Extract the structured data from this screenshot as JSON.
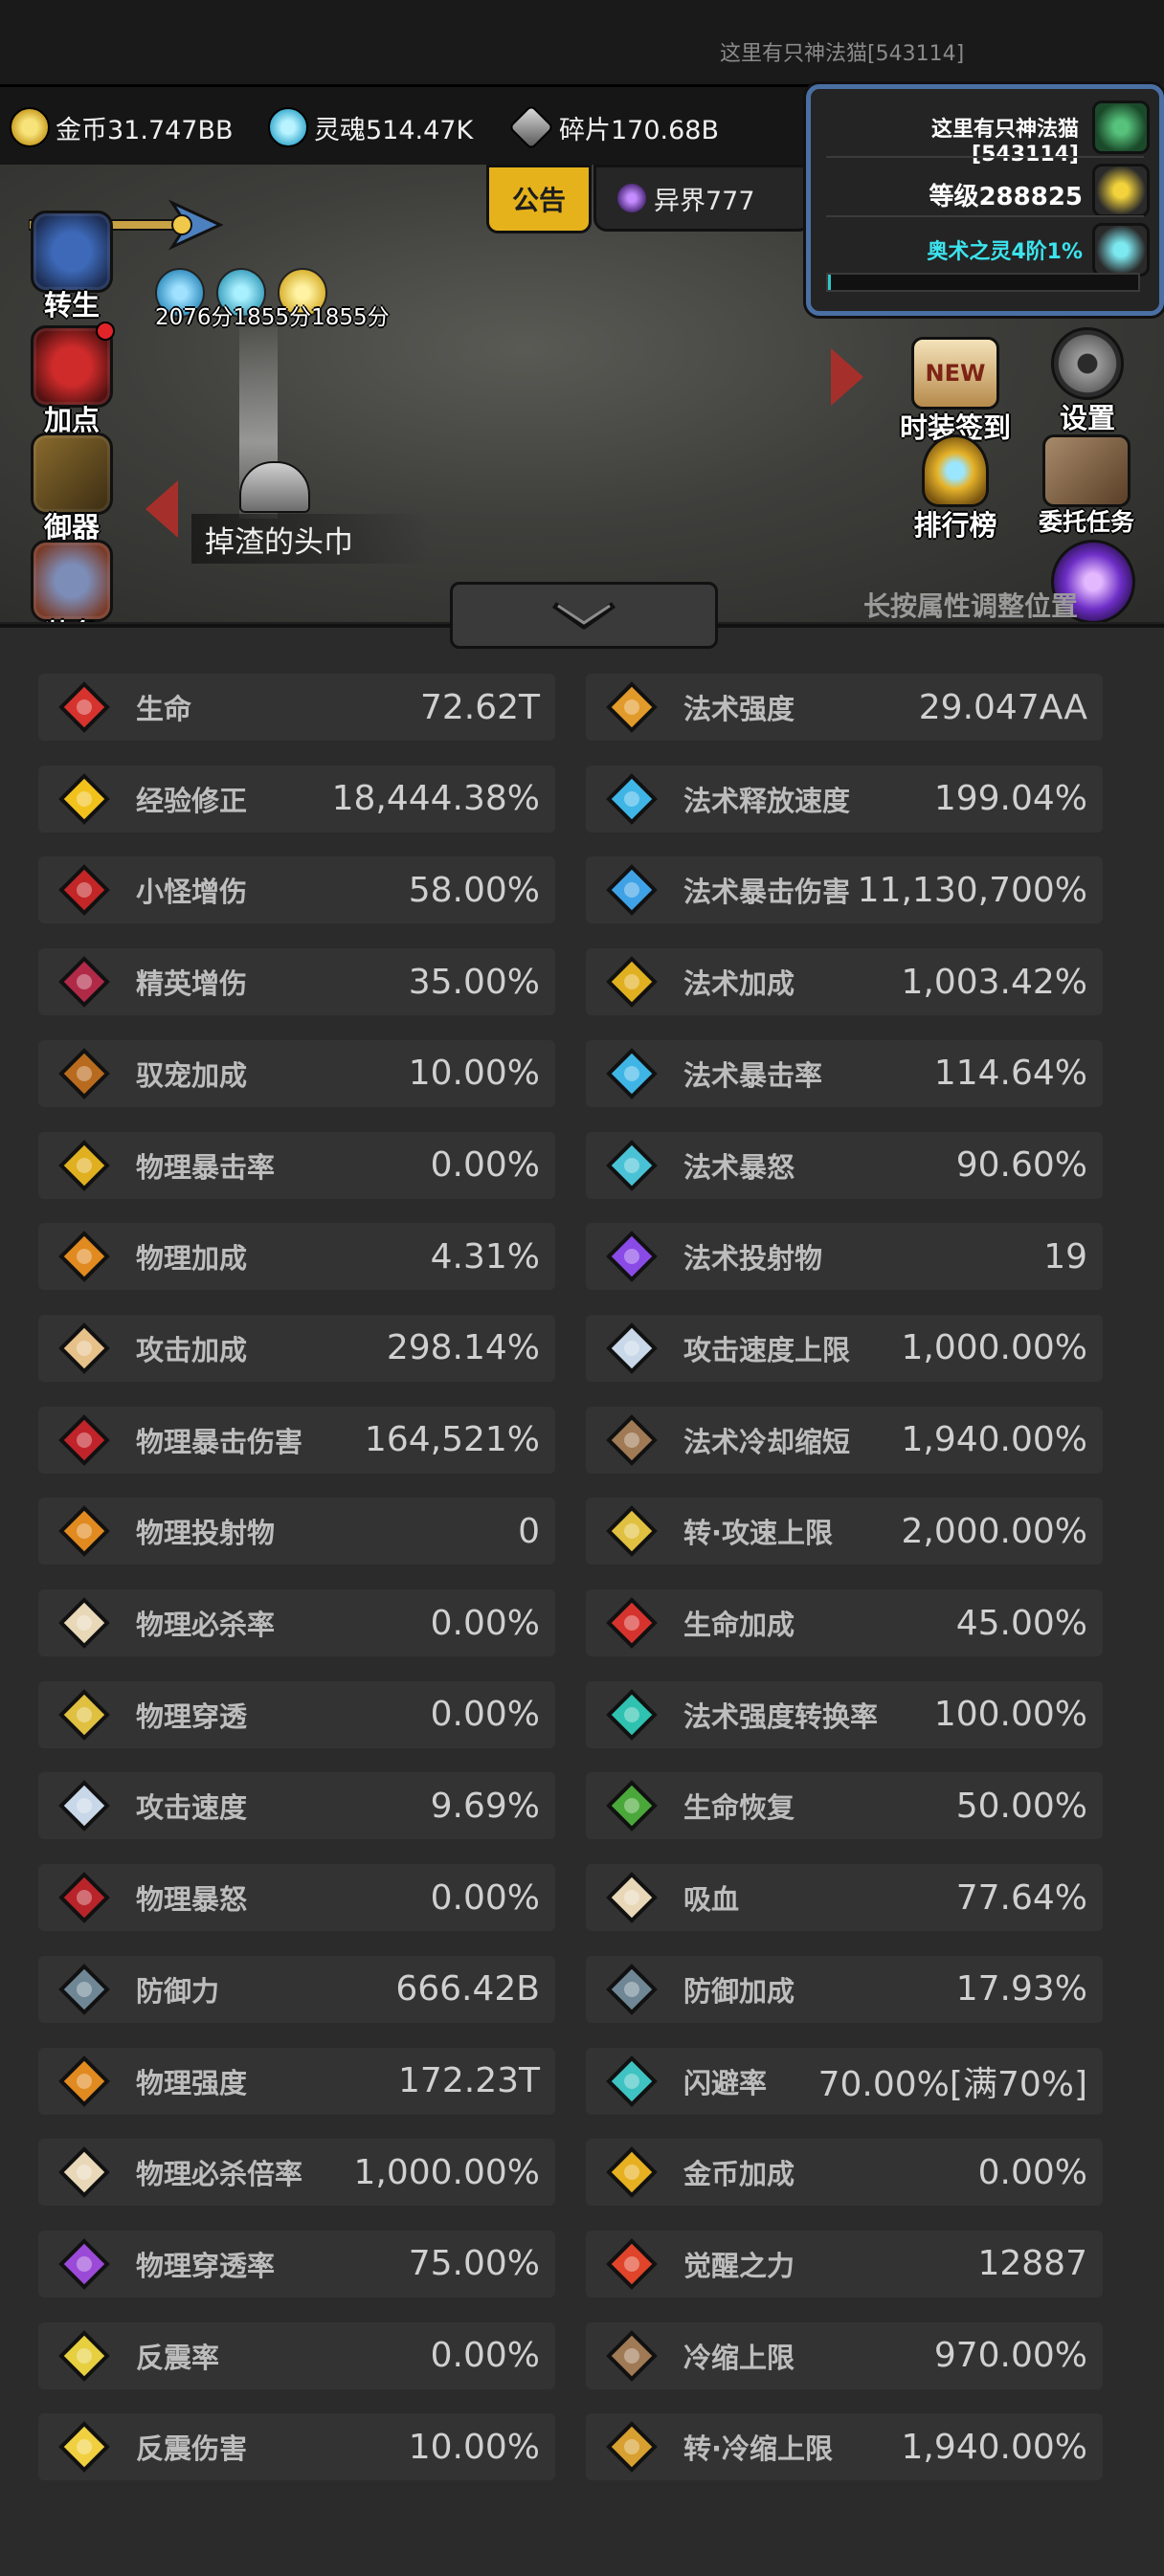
{
  "header": {
    "title": "这里有只神法猫[543114]"
  },
  "resources": [
    {
      "label": "金币31.747BB",
      "icon": "gold-coin-icon"
    },
    {
      "label": "灵魂514.47K",
      "icon": "soul-icon"
    },
    {
      "label": "碎片170.68B",
      "icon": "fragment-icon"
    }
  ],
  "top_buttons": {
    "announcement": "公告",
    "otherworld": "异界777"
  },
  "buff_scores": "2076分1855分1855分",
  "left_menu": [
    "转生",
    "加点",
    "御器",
    "装备"
  ],
  "drop_item": "掉渣的头巾",
  "right_menu": {
    "costume": "时装签到",
    "costume_badge": "NEW",
    "settings": "设置",
    "ranking": "排行榜",
    "tasks": "委托任务"
  },
  "hint": "长按属性调整位置",
  "player": {
    "name": "这里有只神法猫[543114]",
    "level": "等级288825",
    "spirit": "奥术之灵4阶1%",
    "spirit_progress": 0.01
  },
  "stats_left": [
    {
      "label": "生命",
      "value": "72.62T",
      "icon": "heart-icon",
      "color": "#d6332e"
    },
    {
      "label": "经验修正",
      "value": "18,444.38%",
      "icon": "crown-icon",
      "color": "#f2c21c"
    },
    {
      "label": "小怪增伤",
      "value": "58.00%",
      "icon": "demon-face-icon",
      "color": "#c22626"
    },
    {
      "label": "精英增伤",
      "value": "35.00%",
      "icon": "elite-helmet-icon",
      "color": "#b02a48"
    },
    {
      "label": "驭宠加成",
      "value": "10.00%",
      "icon": "paw-icon",
      "color": "#b86b1e"
    },
    {
      "label": "物理暴击率",
      "value": "0.00%",
      "icon": "crit-burst-icon",
      "color": "#e0b020"
    },
    {
      "label": "物理加成",
      "value": "4.31%",
      "icon": "sword-up-icon",
      "color": "#e08a20"
    },
    {
      "label": "攻击加成",
      "value": "298.14%",
      "icon": "crossed-swords-icon",
      "color": "#e6c28a"
    },
    {
      "label": "物理暴击伤害",
      "value": "164,521%",
      "icon": "blood-slash-icon",
      "color": "#c0242a"
    },
    {
      "label": "物理投射物",
      "value": "0",
      "icon": "boomerang-icon",
      "color": "#e08a20"
    },
    {
      "label": "物理必杀率",
      "value": "0.00%",
      "icon": "skull-icon",
      "color": "#e8d8b8"
    },
    {
      "label": "物理穿透",
      "value": "0.00%",
      "icon": "pierce-arrow-icon",
      "color": "#e0c040"
    },
    {
      "label": "攻击速度",
      "value": "9.69%",
      "icon": "speed-sword-icon",
      "color": "#c8d8e8"
    },
    {
      "label": "物理暴怒",
      "value": "0.00%",
      "icon": "rage-claw-icon",
      "color": "#b8242a"
    },
    {
      "label": "防御力",
      "value": "666.42B",
      "icon": "shield-icon",
      "color": "#6f8795"
    },
    {
      "label": "物理强度",
      "value": "172.23T",
      "icon": "spear-icon",
      "color": "#e08a20"
    },
    {
      "label": "物理必杀倍率",
      "value": "1,000.00%",
      "icon": "skull-sword-icon",
      "color": "#e8d8b8"
    },
    {
      "label": "物理穿透率",
      "value": "75.00%",
      "icon": "purple-pierce-icon",
      "color": "#9b4ad8"
    },
    {
      "label": "反震率",
      "value": "0.00%",
      "icon": "thorn-icon",
      "color": "#e6d040"
    },
    {
      "label": "反震伤害",
      "value": "10.00%",
      "icon": "thorn-burst-icon",
      "color": "#f0d040"
    }
  ],
  "stats_right": [
    {
      "label": "法术强度",
      "value": "29.047AA",
      "icon": "magic-claw-icon",
      "color": "#e29a2a"
    },
    {
      "label": "法术释放速度",
      "value": "199.04%",
      "icon": "mage-hat-icon",
      "color": "#3fb5e6"
    },
    {
      "label": "法术暴击伤害",
      "value": "11,130,700%",
      "icon": "magic-burst-icon",
      "color": "#3fa2e6"
    },
    {
      "label": "法术加成",
      "value": "1,003.42%",
      "icon": "magic-plus-icon",
      "color": "#e0b020"
    },
    {
      "label": "法术暴击率",
      "value": "114.64%",
      "icon": "magic-crit-icon",
      "color": "#3fb5e6"
    },
    {
      "label": "法术暴怒",
      "value": "90.60%",
      "icon": "magic-rage-icon",
      "color": "#4ac2d6"
    },
    {
      "label": "法术投射物",
      "value": "19",
      "icon": "magic-missile-icon",
      "color": "#8a4ae6"
    },
    {
      "label": "攻击速度上限",
      "value": "1,000.00%",
      "icon": "speed-cap-icon",
      "color": "#c8d8e8"
    },
    {
      "label": "法术冷却缩短",
      "value": "1,940.00%",
      "icon": "hourglass-icon",
      "color": "#a07a55"
    },
    {
      "label": "转·攻速上限",
      "value": "2,000.00%",
      "icon": "golden-sword-icon",
      "color": "#e0c040"
    },
    {
      "label": "生命加成",
      "value": "45.00%",
      "icon": "heart-plus-icon",
      "color": "#d6332e"
    },
    {
      "label": "法术强度转换率",
      "value": "100.00%",
      "icon": "magic-convert-icon",
      "color": "#2fc2b0"
    },
    {
      "label": "生命恢复",
      "value": "50.00%",
      "icon": "sprout-icon",
      "color": "#4aa83a"
    },
    {
      "label": "吸血",
      "value": "77.64%",
      "icon": "vampire-skull-icon",
      "color": "#e8d8b8"
    },
    {
      "label": "防御加成",
      "value": "17.93%",
      "icon": "shield-plus-icon",
      "color": "#6f8795"
    },
    {
      "label": "闪避率",
      "value": "70.00%[满70%]",
      "icon": "dodge-boot-icon",
      "color": "#3fc2c2"
    },
    {
      "label": "金币加成",
      "value": "0.00%",
      "icon": "coin-stack-icon",
      "color": "#e6b020"
    },
    {
      "label": "觉醒之力",
      "value": "12887",
      "icon": "awaken-flame-icon",
      "color": "#e0442a"
    },
    {
      "label": "冷缩上限",
      "value": "970.00%",
      "icon": "hourglass-cap-icon",
      "color": "#a07a55"
    },
    {
      "label": "转·冷缩上限",
      "value": "1,940.00%",
      "icon": "golden-hourglass-icon",
      "color": "#d8a030"
    }
  ]
}
